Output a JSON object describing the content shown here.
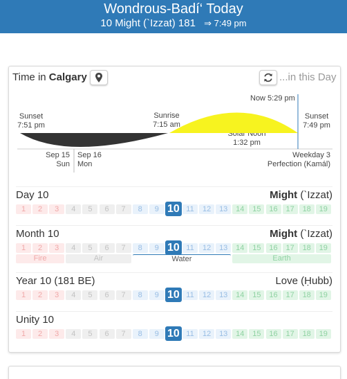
{
  "header": {
    "title": "Wondrous-Badí‘ Today",
    "date_line": "10 Might (`Izzat) 181",
    "sunset_arrow": "⇒",
    "sunset_time": "7:49 pm"
  },
  "location": {
    "prefix": "Time in",
    "city": "Calgary",
    "pin_icon": "map-pin-icon",
    "refresh_icon": "refresh-icon",
    "in_this_day": "...in this Day"
  },
  "sun_chart": {
    "now_label": "Now 5:29 pm",
    "sunset_left": {
      "label": "Sunset",
      "time": "7:51 pm"
    },
    "sunrise": {
      "label": "Sunrise",
      "time": "7:15 am"
    },
    "solar_noon": {
      "label": "Solar Noon",
      "time": "1:32 pm"
    },
    "sunset_right": {
      "label": "Sunset",
      "time": "7:49 pm"
    },
    "day_prev": {
      "date": "Sep 15",
      "weekday": "Sun"
    },
    "day_curr": {
      "date": "Sep 16",
      "weekday": "Mon"
    },
    "badi_weekday": {
      "label": "Weekday 3",
      "name": "Perfection (Kamál)"
    },
    "colors": {
      "night": "#333333",
      "day": "#f7f31f",
      "now_line": "#2f7ab7"
    }
  },
  "rows": [
    {
      "id": "day",
      "title": "Day 10",
      "name_bold": "Might",
      "name_rest": " (`Izzat)",
      "current": 10,
      "show_elements": false
    },
    {
      "id": "month",
      "title": "Month 10",
      "name_bold": "Might",
      "name_rest": " (`Izzat)",
      "current": 10,
      "show_elements": true
    },
    {
      "id": "year",
      "title": "Year 10 (181 BE)",
      "name_bold": "",
      "name_rest": "Love (Ḥubb)",
      "current": 10,
      "show_elements": false
    },
    {
      "id": "unity",
      "title": "Unity 10",
      "name_bold": "",
      "name_rest": "",
      "current": 10,
      "show_elements": false
    }
  ],
  "numbers": [
    "1",
    "2",
    "3",
    "4",
    "5",
    "6",
    "7",
    "8",
    "9",
    "10",
    "11",
    "12",
    "13",
    "14",
    "15",
    "16",
    "17",
    "18",
    "19"
  ],
  "elements": [
    {
      "name": "Fire",
      "from": 1,
      "to": 3
    },
    {
      "name": "Air",
      "from": 4,
      "to": 7
    },
    {
      "name": "Water",
      "from": 8,
      "to": 13
    },
    {
      "name": "Earth",
      "from": 14,
      "to": 19
    }
  ]
}
